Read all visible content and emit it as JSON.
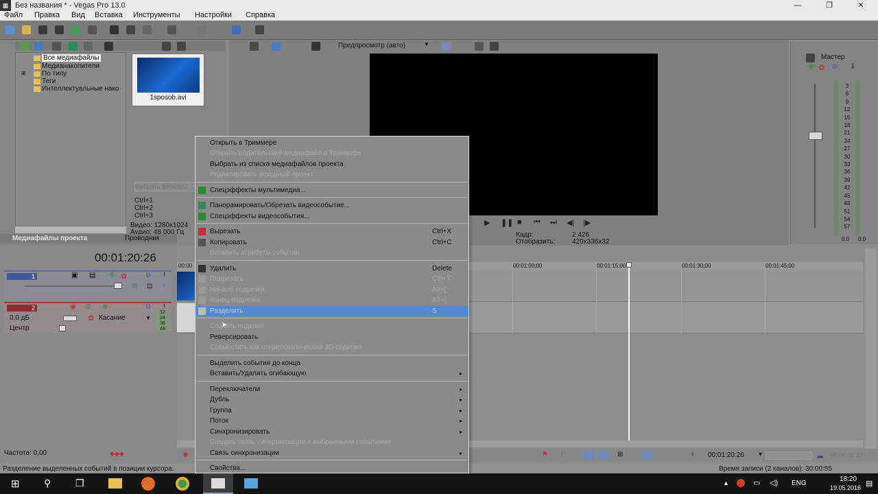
{
  "window": {
    "title": "Без названия * - Vegas Pro 13.0",
    "app_icon": "vegas-icon",
    "minimize": "—",
    "restore": "❐",
    "close": "✕"
  },
  "menubar": [
    "Файл",
    "Правка",
    "Вид",
    "Вставка",
    "Инструменты",
    "Настройки",
    "Справка"
  ],
  "explorer": {
    "tree": [
      "Все медиафайлы",
      "Медианакопители",
      "По типу",
      "Теги",
      "Интеллектуальные нако"
    ],
    "media_file": "1sposob.avi",
    "search_placeholder": "Выбрать фильтры",
    "shortcuts": [
      "Ctrl+1",
      "Ctrl+2",
      "Ctrl+3"
    ],
    "video_info": "Видео: 1280x1024",
    "audio_info": "Аудио: 48 000 Гц",
    "tab_media": "Медиафайлы проекта",
    "tab_explorer": "Проводник"
  },
  "preview": {
    "mode": "Предпросмотр (авто)",
    "frame_label": "Кадр:",
    "frame_value": "2 426",
    "display_label": "Отобразить:",
    "display_value": "420x336x32"
  },
  "mixer": {
    "title": "Мастер",
    "scale": [
      "3",
      "6",
      "9",
      "12",
      "15",
      "18",
      "21",
      "24",
      "27",
      "30",
      "33",
      "36",
      "39",
      "42",
      "45",
      "48",
      "51",
      "54",
      "57"
    ],
    "left_value": "0.0",
    "right_value": "0.0"
  },
  "timeline": {
    "timecode": "00:01:20:26",
    "ruler_start": "00:00",
    "ruler": [
      "00:01:00;00",
      "00:01:15;00",
      "00:01:30;00",
      "00:01:45;00"
    ],
    "track1_number": "1",
    "track2_number": "2",
    "volume": "0,0 дБ",
    "pan": "Центр",
    "touch_mode": "Касание",
    "meter_values": [
      "12",
      "24",
      "36",
      "48"
    ],
    "rate": "Частота: 0,00",
    "cursor_time": "00:01:20:26",
    "end_time": "00:00:01:22"
  },
  "context_menu": {
    "items": [
      {
        "label": "Открыть в Триммере",
        "shortcut": "",
        "disabled": false
      },
      {
        "label": "Открыть родительский медиафайл в Триммере",
        "shortcut": "",
        "disabled": true
      },
      {
        "label": "Выбрать из списка медиафайлов проекта",
        "shortcut": "",
        "disabled": false
      },
      {
        "label": "Редактировать исходный проект",
        "shortcut": "",
        "disabled": true
      },
      {
        "label": "Спецэффекты мультимедиа...",
        "shortcut": "",
        "disabled": false
      },
      {
        "label": "Панорамировать/Обрезать видеособытие...",
        "shortcut": "",
        "disabled": false
      },
      {
        "label": "Спецэффекты видеособытия...",
        "shortcut": "",
        "disabled": false
      },
      {
        "label": "Вырезать",
        "shortcut": "Ctrl+X",
        "disabled": false
      },
      {
        "label": "Копировать",
        "shortcut": "Ctrl+C",
        "disabled": false
      },
      {
        "label": "Вставить атрибуты события",
        "shortcut": "",
        "disabled": true
      },
      {
        "label": "Удалить",
        "shortcut": "Delete",
        "disabled": false
      },
      {
        "label": "Подрезать",
        "shortcut": "Ctrl+T",
        "disabled": true
      },
      {
        "label": "Начало подрезки",
        "shortcut": "Alt+[",
        "disabled": true
      },
      {
        "label": "Конец подрезки",
        "shortcut": "Alt+]",
        "disabled": true
      },
      {
        "label": "Разделить",
        "shortcut": "S",
        "disabled": false
      },
      {
        "label": "Создать подклип",
        "shortcut": "",
        "disabled": true
      },
      {
        "label": "Реверсировать",
        "shortcut": "",
        "disabled": false
      },
      {
        "label": "Совместить как стереоскопический 3D-подклип",
        "shortcut": "",
        "disabled": true
      },
      {
        "label": "Выделить события до конца",
        "shortcut": "",
        "disabled": false
      },
      {
        "label": "Вставить/Удалить огибающую",
        "shortcut": "",
        "disabled": false
      },
      {
        "label": "Переключатели",
        "shortcut": "",
        "disabled": false
      },
      {
        "label": "Дубль",
        "shortcut": "",
        "disabled": false
      },
      {
        "label": "Группа",
        "shortcut": "",
        "disabled": false
      },
      {
        "label": "Поток",
        "shortcut": "",
        "disabled": false
      },
      {
        "label": "Синхронизировать",
        "shortcut": "",
        "disabled": false
      },
      {
        "label": "Создать связь синхронизации с выбранными событиями",
        "shortcut": "",
        "disabled": true
      },
      {
        "label": "Связь синхронизации",
        "shortcut": "",
        "disabled": false
      },
      {
        "label": "Свойства...",
        "shortcut": "",
        "disabled": false
      }
    ],
    "submenu_arrow": "▸"
  },
  "status": {
    "hint": "Разделение выделенных событий в позиции курсора.",
    "record_time": "Время записи (2 каналов): 30:00:55"
  },
  "taskbar": {
    "lang": "ENG",
    "time": "18:20",
    "date": "19.05.2016"
  },
  "colors": {
    "highlight": "#4f8ad9",
    "folder": "#e6c15a",
    "playhead": "#ffffff"
  }
}
